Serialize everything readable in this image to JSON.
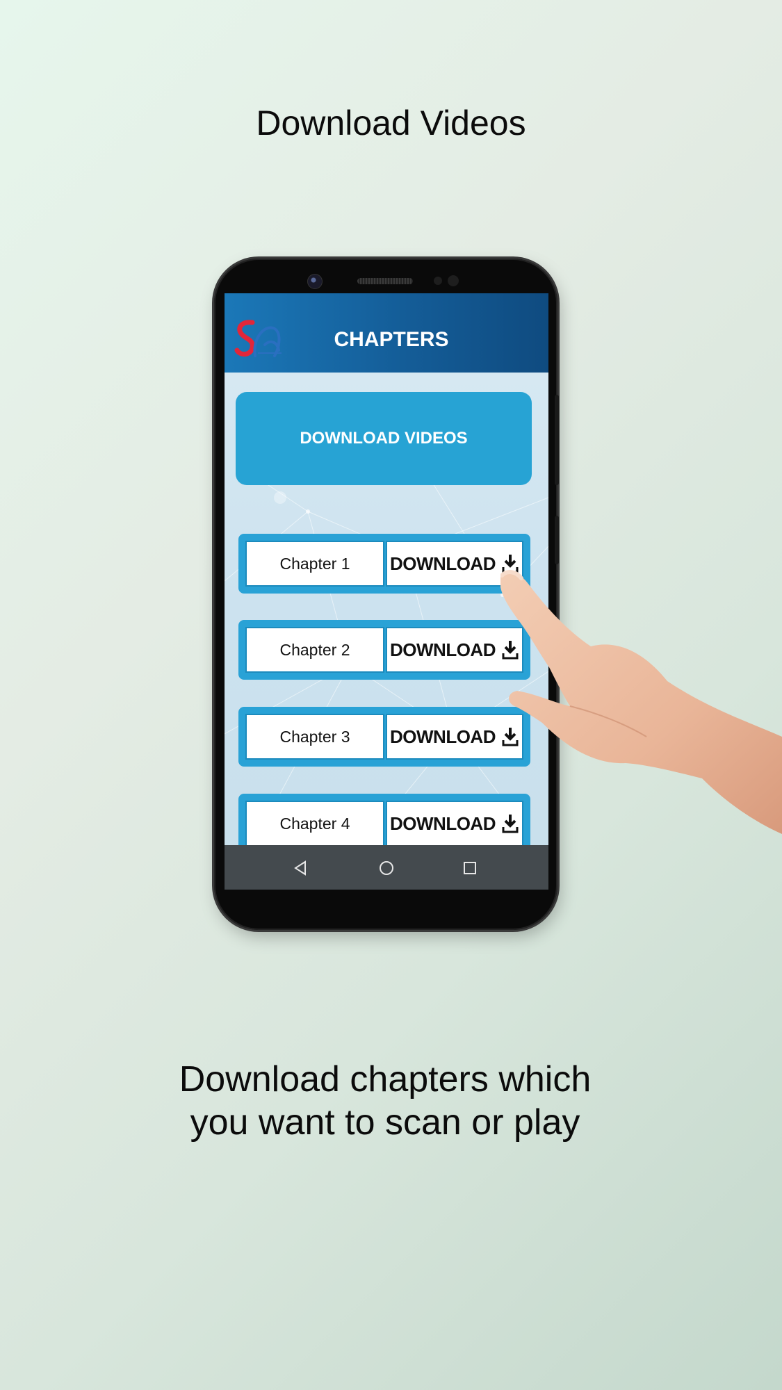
{
  "headline": "Download Videos",
  "caption": {
    "line1": "Download chapters which",
    "line2": "you want to scan or play"
  },
  "app": {
    "logo_text": "SA",
    "title": "CHAPTERS",
    "download_videos_label": "DOWNLOAD VIDEOS",
    "chapters": [
      {
        "name": "Chapter 1",
        "action": "DOWNLOAD"
      },
      {
        "name": "Chapter 2",
        "action": "DOWNLOAD"
      },
      {
        "name": "Chapter 3",
        "action": "DOWNLOAD"
      },
      {
        "name": "Chapter 4",
        "action": "DOWNLOAD"
      }
    ]
  },
  "navbar": {
    "icons": [
      "back-icon",
      "home-icon",
      "recents-icon"
    ]
  },
  "colors": {
    "appbar": "#145d98",
    "accent": "#27a3d4",
    "navbar": "#444a4e"
  }
}
